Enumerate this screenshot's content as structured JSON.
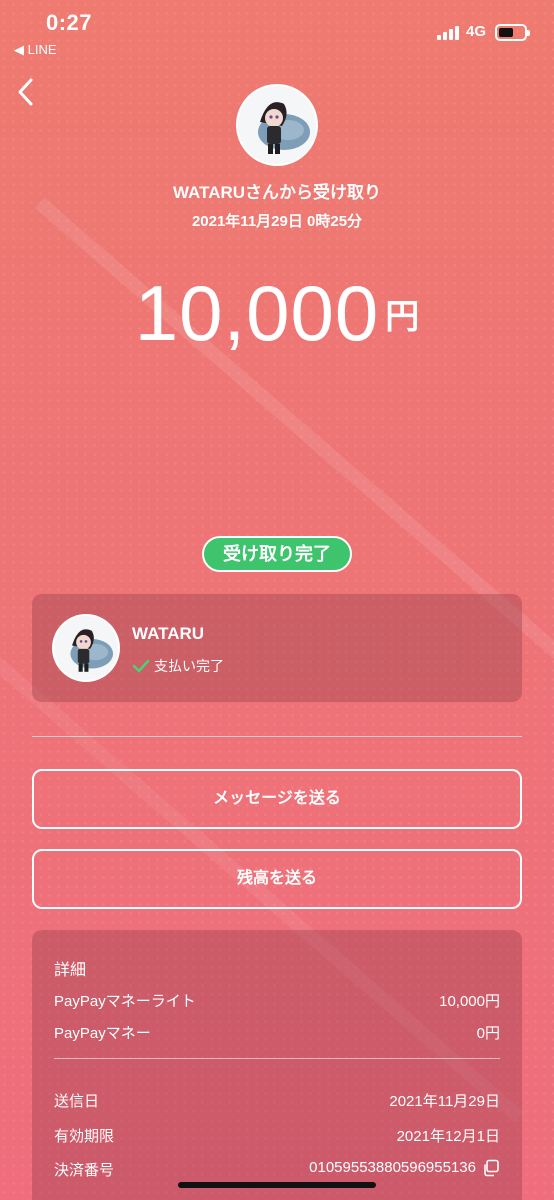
{
  "status_bar": {
    "time": "0:27",
    "back_app": "◀ LINE",
    "network": "4G"
  },
  "header": {
    "title": "WATARUさんから受け取り",
    "date": "2021年11月29日 0時25分"
  },
  "amount": {
    "value": "10,000",
    "currency": "円"
  },
  "badge": "受け取り完了",
  "sender_card": {
    "name": "WATARU",
    "status": "支払い完了"
  },
  "buttons": {
    "send_message": "メッセージを送る",
    "send_balance": "残高を送る"
  },
  "details": {
    "title": "詳細",
    "breakdown": [
      {
        "label": "PayPayマネーライト",
        "value": "10,000円"
      },
      {
        "label": "PayPayマネー",
        "value": "0円"
      }
    ],
    "info": [
      {
        "label": "送信日",
        "value": "2021年11月29日"
      },
      {
        "label": "有効期限",
        "value": "2021年12月1日"
      },
      {
        "label": "決済番号",
        "value": "01059553880596955136"
      }
    ]
  },
  "colors": {
    "background_top": "#ee7a70",
    "background_bottom": "#ef6d7d",
    "badge_green": "#3ec46d",
    "check_green": "#48d37a"
  },
  "icons": [
    "back-chevron-icon",
    "signal-icon",
    "battery-icon",
    "check-icon",
    "copy-icon"
  ]
}
